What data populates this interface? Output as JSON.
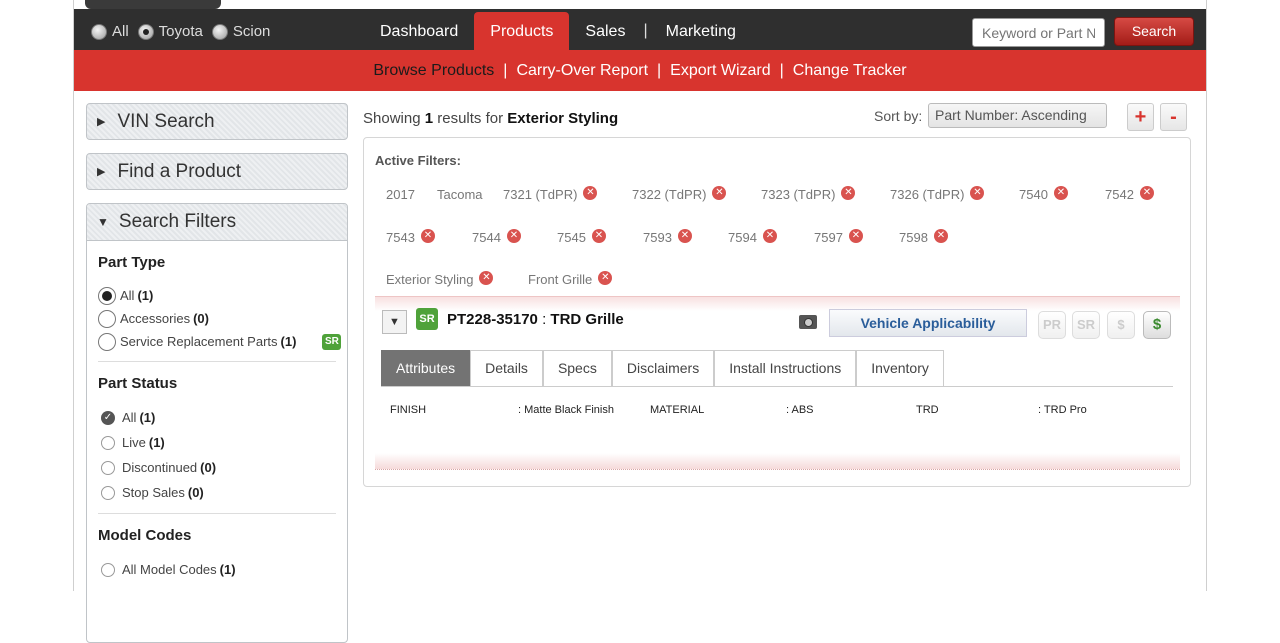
{
  "brand_filter": {
    "options": [
      {
        "label": "All",
        "selected": false
      },
      {
        "label": "Toyota",
        "selected": true
      },
      {
        "label": "Scion",
        "selected": false
      }
    ]
  },
  "main_nav": {
    "items": [
      "Dashboard",
      "Products",
      "Sales",
      "Marketing"
    ],
    "active": "Products"
  },
  "search": {
    "placeholder": "Keyword or Part No",
    "button_label": "Search"
  },
  "sub_nav": {
    "items": [
      "Browse Products",
      "Carry-Over Report",
      "Export Wizard",
      "Change Tracker"
    ],
    "active": "Browse Products"
  },
  "sidebar": {
    "vin_search": "VIN Search",
    "find_product": "Find a Product",
    "search_filters": "Search Filters",
    "part_type": {
      "title": "Part Type",
      "options": [
        {
          "label": "All",
          "count": "(1)",
          "selected": true
        },
        {
          "label": "Accessories",
          "count": "(0)",
          "selected": false
        },
        {
          "label": "Service Replacement Parts",
          "count": "(1)",
          "selected": false,
          "badge": "SR"
        }
      ]
    },
    "part_status": {
      "title": "Part Status",
      "options": [
        {
          "label": "All",
          "count": "(1)",
          "selected": true
        },
        {
          "label": "Live",
          "count": "(1)",
          "selected": false
        },
        {
          "label": "Discontinued",
          "count": "(0)",
          "selected": false
        },
        {
          "label": "Stop Sales",
          "count": "(0)",
          "selected": false
        }
      ]
    },
    "model_codes": {
      "title": "Model Codes",
      "options": [
        {
          "label": "All Model Codes",
          "count": "(1)",
          "selected": false
        }
      ]
    }
  },
  "results": {
    "showing_prefix": "Showing",
    "count": "1",
    "results_for": "results for",
    "query": "Exterior Styling",
    "sort_label": "Sort by:",
    "sort_value": "Part Number: Ascending",
    "plus": "+",
    "minus": "-"
  },
  "active_filters": {
    "label": "Active Filters:",
    "chips": [
      {
        "text": "2017",
        "removable": false
      },
      {
        "text": "Tacoma",
        "removable": false
      },
      {
        "text": "7321 (TdPR)",
        "removable": true
      },
      {
        "text": "7322 (TdPR)",
        "removable": true
      },
      {
        "text": "7323 (TdPR)",
        "removable": true
      },
      {
        "text": "7326 (TdPR)",
        "removable": true
      },
      {
        "text": "7540",
        "removable": true
      },
      {
        "text": "7542",
        "removable": true
      },
      {
        "text": "7543",
        "removable": true
      },
      {
        "text": "7544",
        "removable": true
      },
      {
        "text": "7545",
        "removable": true
      },
      {
        "text": "7593",
        "removable": true
      },
      {
        "text": "7594",
        "removable": true
      },
      {
        "text": "7597",
        "removable": true
      },
      {
        "text": "7598",
        "removable": true
      },
      {
        "text": "Exterior Styling",
        "removable": true
      },
      {
        "text": "Front Grille",
        "removable": true
      }
    ]
  },
  "product": {
    "badge": "SR",
    "part_number": "PT228-35170",
    "separator": ":",
    "name": "TRD Grille",
    "vehicle_applicability": "Vehicle Applicability",
    "icon_buttons": [
      {
        "label": "PR",
        "active": false
      },
      {
        "label": "SR",
        "active": false
      },
      {
        "label": "$",
        "active": false
      },
      {
        "label": "$",
        "active": true
      }
    ],
    "tabs": [
      "Attributes",
      "Details",
      "Specs",
      "Disclaimers",
      "Install Instructions",
      "Inventory"
    ],
    "active_tab": "Attributes",
    "attributes": [
      {
        "key": "FINISH",
        "value": ": Matte Black Finish"
      },
      {
        "key": "MATERIAL",
        "value": ": ABS"
      },
      {
        "key": "TRD",
        "value": ": TRD Pro"
      }
    ]
  },
  "colors": {
    "brand_red": "#d8342e",
    "topbar": "#2f2f2f",
    "sr_green": "#4fa23a",
    "link_blue": "#2a5d9a"
  }
}
